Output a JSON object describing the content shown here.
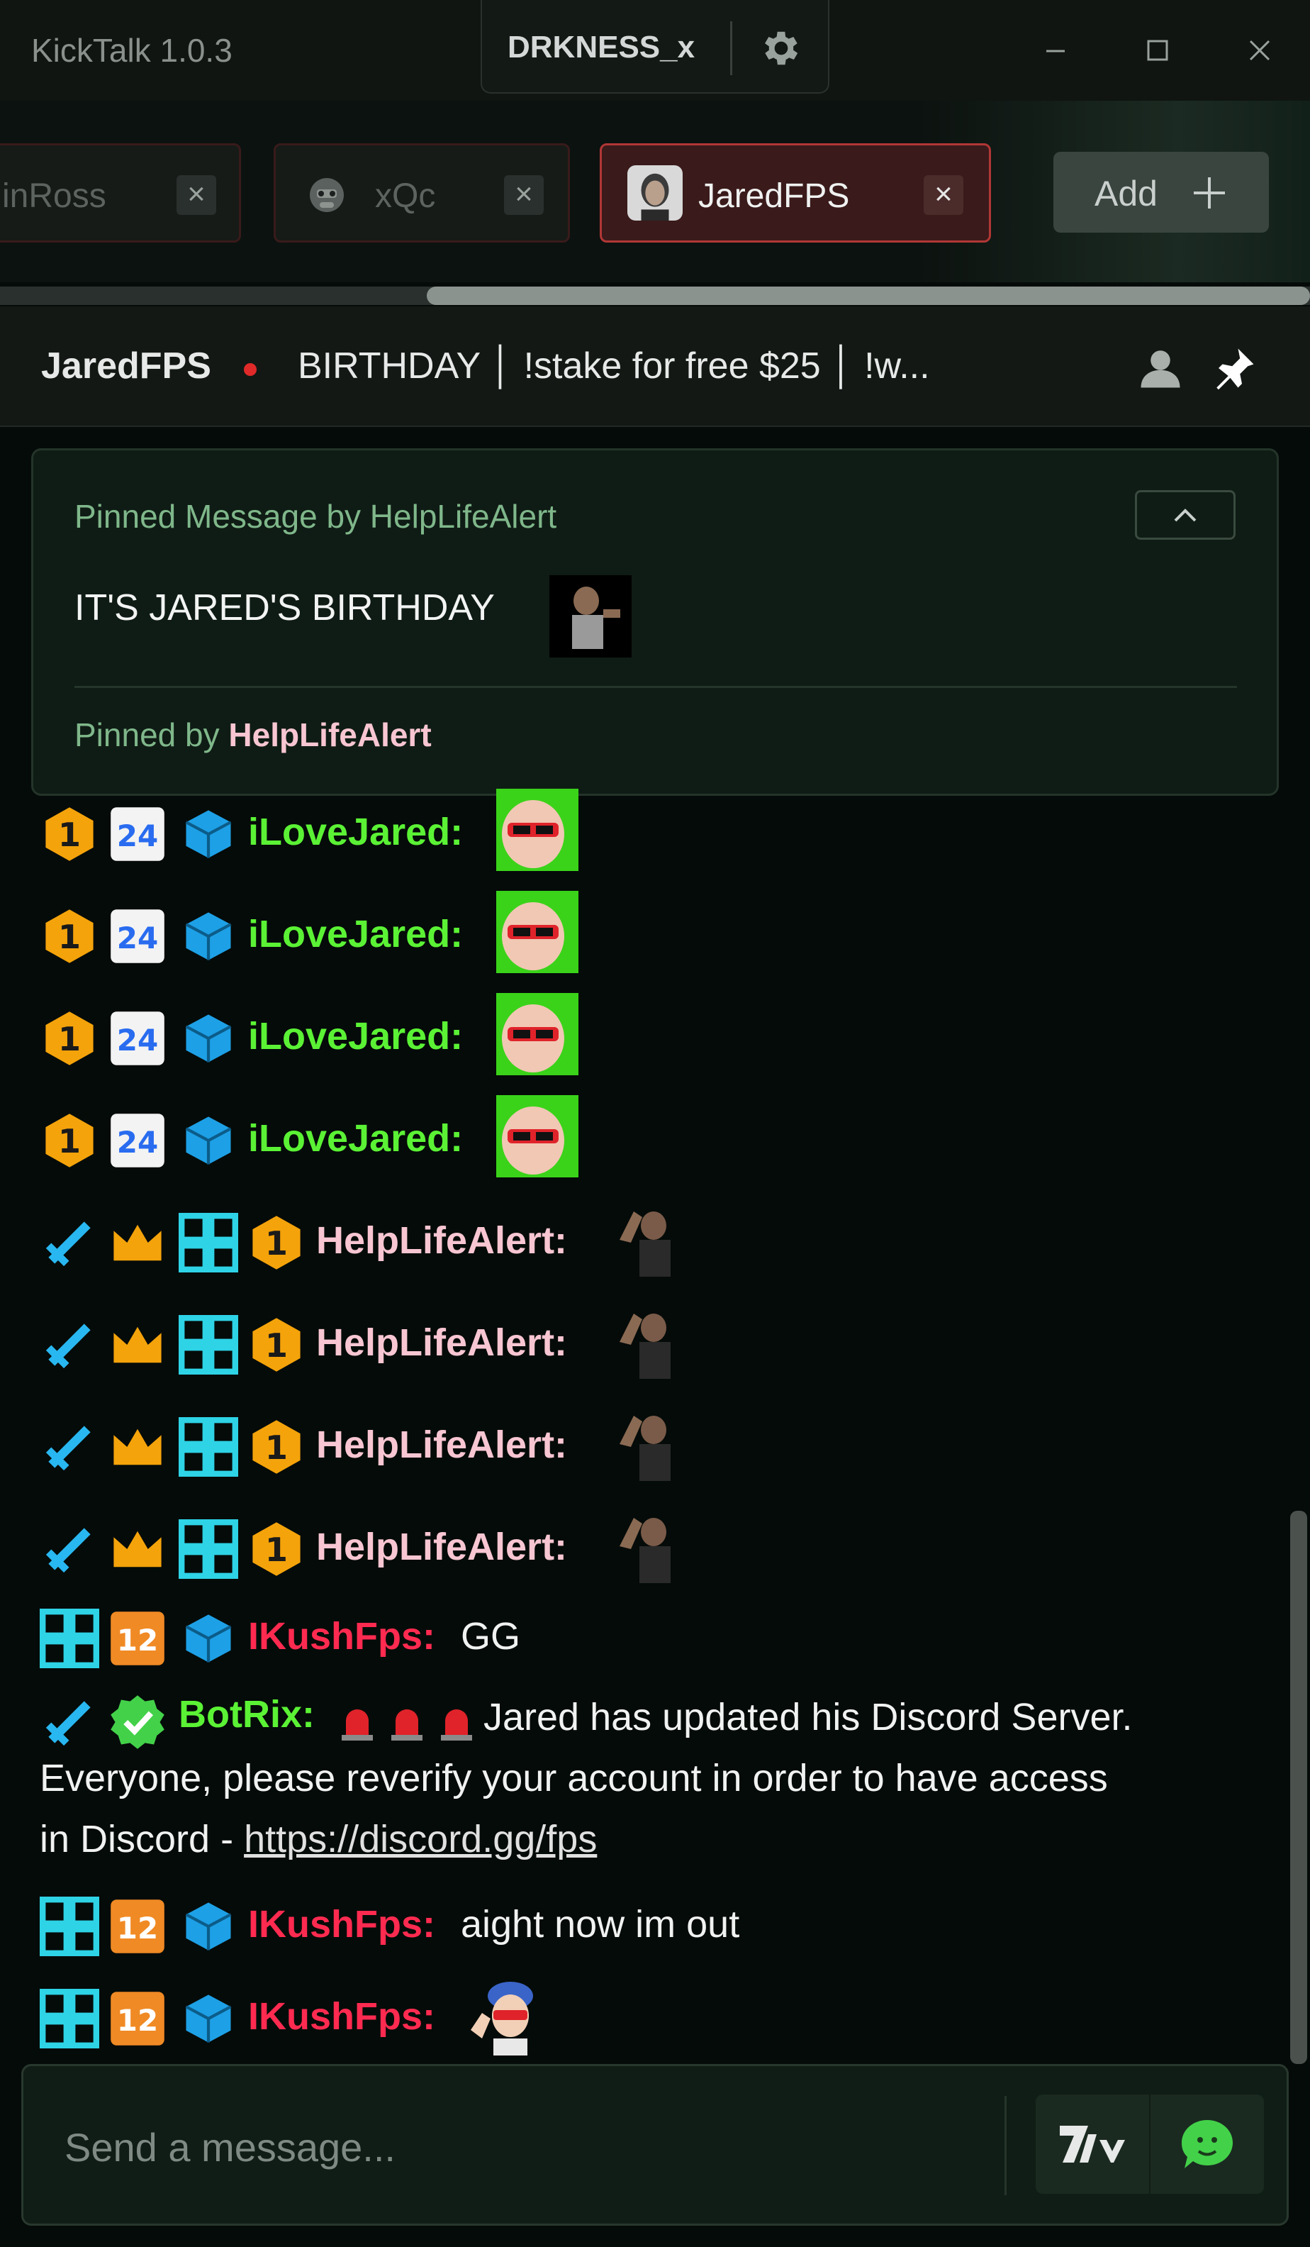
{
  "app": {
    "title": "KickTalk 1.0.3"
  },
  "account": {
    "username": "DRKNESS_x"
  },
  "tabs": [
    {
      "label": "inRoss",
      "close": "×"
    },
    {
      "label": "xQc",
      "close": "×"
    },
    {
      "label": "JaredFPS",
      "close": "×",
      "active": true
    }
  ],
  "add_button": {
    "label": "Add"
  },
  "channel": {
    "name": "JaredFPS",
    "title": "BIRTHDAY │ !stake for free $25 │ !w..."
  },
  "pinned": {
    "heading": "Pinned Message by HelpLifeAlert",
    "message": "IT'S JARED'S BIRTHDAY",
    "footer_prefix": "Pinned by",
    "footer_user": "HelpLifeAlert"
  },
  "messages": [
    {
      "user": "iLoveJared:",
      "badges": [
        "sub-1",
        "24",
        "cube"
      ],
      "text": "",
      "emote": "sunglasses-baby"
    },
    {
      "user": "iLoveJared:",
      "badges": [
        "sub-1",
        "24",
        "cube"
      ],
      "text": "",
      "emote": "sunglasses-baby"
    },
    {
      "user": "iLoveJared:",
      "badges": [
        "sub-1",
        "24",
        "cube"
      ],
      "text": "",
      "emote": "sunglasses-baby"
    },
    {
      "user": "iLoveJared:",
      "badges": [
        "sub-1",
        "24",
        "cube"
      ],
      "text": "",
      "emote": "sunglasses-baby"
    },
    {
      "user": "HelpLifeAlert:",
      "badges": [
        "sword",
        "crown",
        "og",
        "sub-1"
      ],
      "text": "",
      "emote": "flex"
    },
    {
      "user": "HelpLifeAlert:",
      "badges": [
        "sword",
        "crown",
        "og",
        "sub-1"
      ],
      "text": "",
      "emote": "flex"
    },
    {
      "user": "HelpLifeAlert:",
      "badges": [
        "sword",
        "crown",
        "og",
        "sub-1"
      ],
      "text": "",
      "emote": "flex"
    },
    {
      "user": "HelpLifeAlert:",
      "badges": [
        "sword",
        "crown",
        "og",
        "sub-1"
      ],
      "text": "",
      "emote": "flex"
    },
    {
      "user": "IKushFps:",
      "badges": [
        "og",
        "12",
        "cube"
      ],
      "text": "GG"
    },
    {
      "user": "IKushFps:",
      "badges": [
        "og",
        "12",
        "cube"
      ],
      "text": "aight now im out"
    },
    {
      "user": "IKushFps:",
      "badges": [
        "og",
        "12",
        "cube"
      ],
      "text": "",
      "emote": "waving-kid"
    }
  ],
  "bot_message": {
    "user": "BotRix:",
    "line1": "Jared has updated his Discord Server.",
    "line2": "Everyone, please reverify your account in order to have access",
    "line3_prefix": "in Discord - ",
    "link": "https://discord.gg/fps"
  },
  "input": {
    "placeholder": "Send a message..."
  },
  "colors": {
    "accent_green": "#53fc18",
    "live_red": "#e02a2a",
    "user_ilovejared": "#5bf235",
    "user_helplifealert": "#f7c6d2",
    "user_ikushfps": "#ff2a4f",
    "user_botrix": "#5bf235"
  }
}
